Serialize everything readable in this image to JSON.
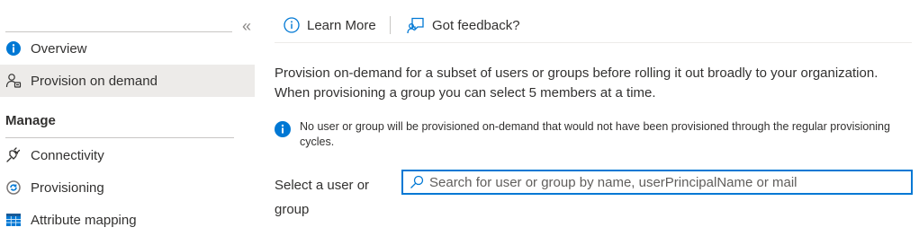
{
  "sidebar": {
    "collapse_glyph": "«",
    "items": [
      {
        "label": "Overview",
        "icon": "info-icon"
      },
      {
        "label": "Provision on demand",
        "icon": "user-provision-icon",
        "selected": true
      }
    ],
    "section_title": "Manage",
    "manage_items": [
      {
        "label": "Connectivity",
        "icon": "plug-icon"
      },
      {
        "label": "Provisioning",
        "icon": "cloud-sync-icon"
      },
      {
        "label": "Attribute mapping",
        "icon": "table-icon"
      }
    ]
  },
  "toolbar": {
    "learn_more_label": "Learn More",
    "feedback_label": "Got feedback?"
  },
  "main": {
    "description": "Provision on-demand for a subset of users or groups before rolling it out broadly to your organization. When provisioning a group you can select 5 members at a time.",
    "info_text": "No user or group will be provisioned on-demand that would not have been provisioned through the regular provisioning cycles.",
    "select_label": "Select a user or group",
    "search": {
      "value": "",
      "placeholder": "Search for user or group by name, userPrincipalName or mail"
    }
  },
  "colors": {
    "accent": "#0078d4",
    "selected_bg": "#edebe9",
    "text": "#323130"
  }
}
